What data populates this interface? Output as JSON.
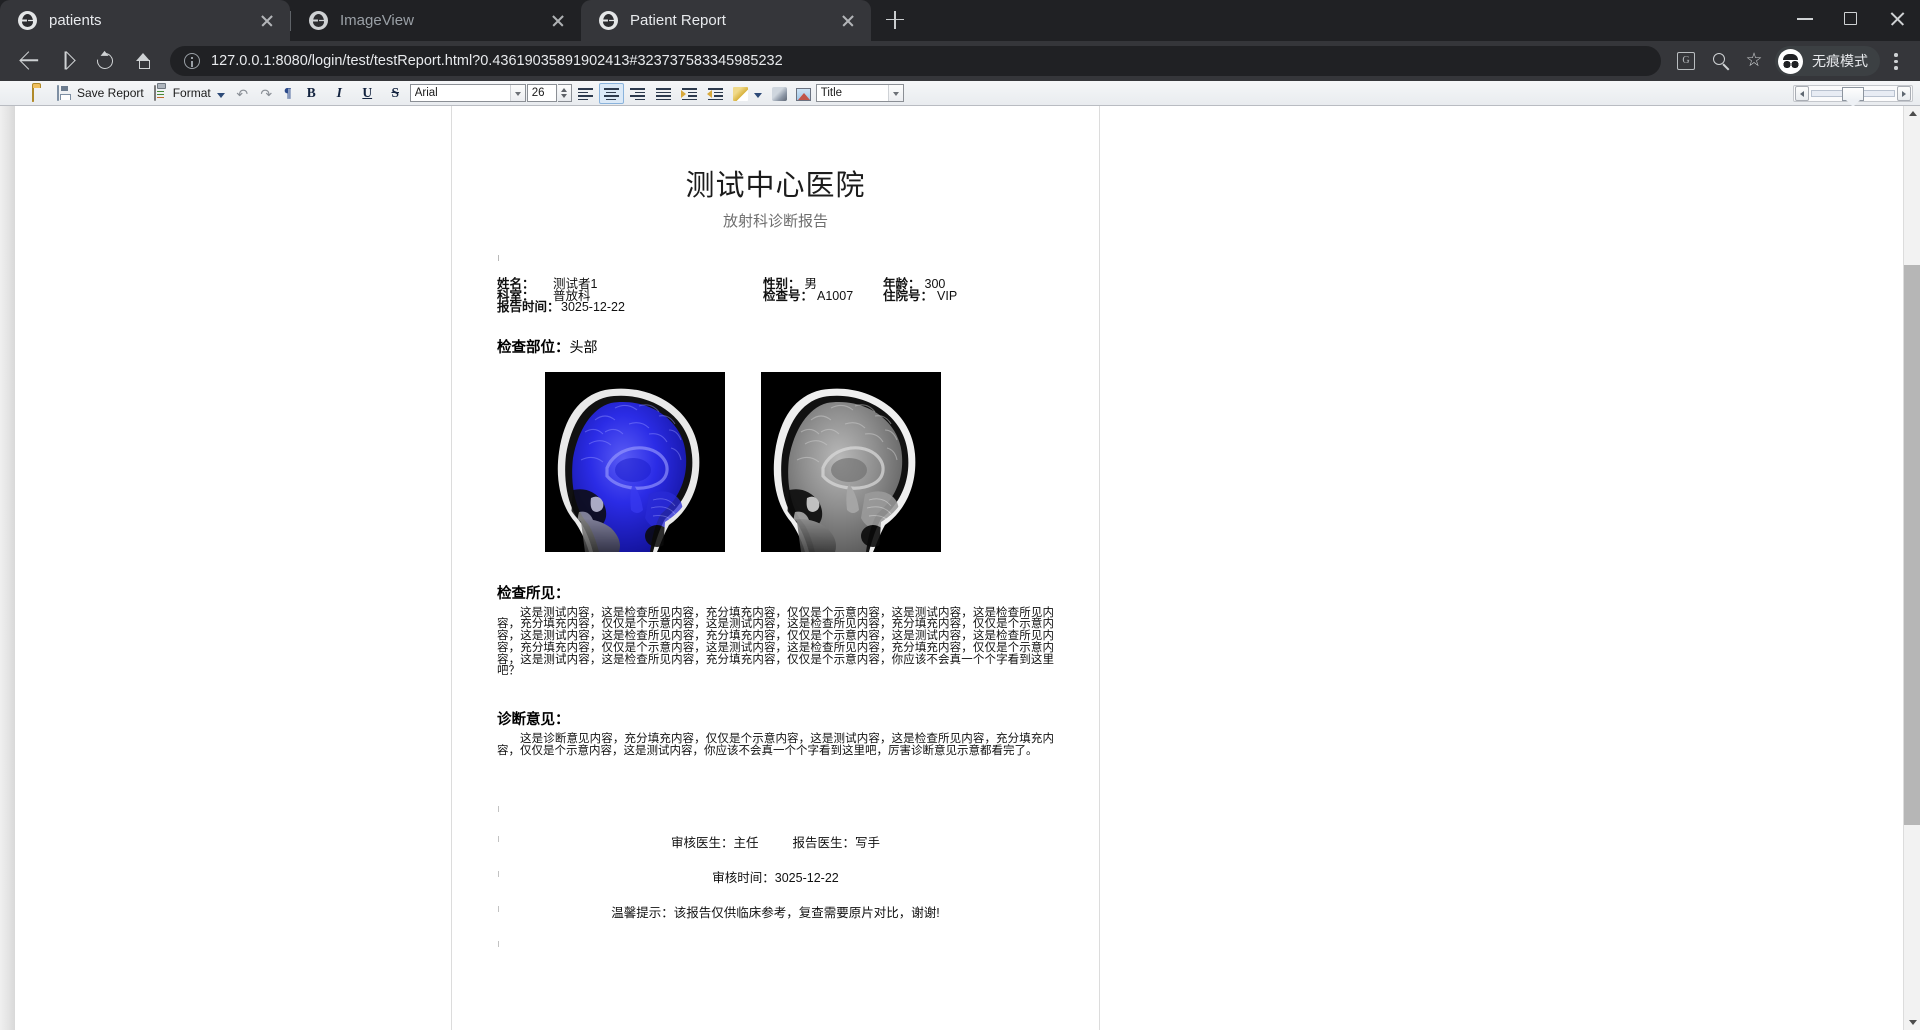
{
  "browser": {
    "tabs": [
      {
        "title": "patients",
        "favicon": "globe-icon",
        "active": false
      },
      {
        "title": "ImageView",
        "favicon": "globe-icon",
        "active": false
      },
      {
        "title": "Patient Report",
        "favicon": "globe-icon",
        "active": true
      }
    ],
    "new_tab_label": "+",
    "window_controls": {
      "minimize": "minimize-icon",
      "maximize": "maximize-icon",
      "close": "close-icon"
    },
    "address": {
      "host": "127.0.0.1",
      "rest": ":8080/login/test/testReport.html?0.43619035891902413#32373758334598523 2",
      "full": "127.0.0.1:8080/login/test/testReport.html?0.43619035891902413#323737583345985232"
    },
    "omni_icons": [
      "translate-icon",
      "search-icon",
      "bookmark-star-icon"
    ],
    "incognito_label": "无痕模式",
    "menu": "kebab-menu-icon"
  },
  "toolbar": {
    "app_icon": "app-icon",
    "open_label": "open-folder-icon",
    "save_label": "Save Report",
    "format_label": "Format",
    "undo_label": "undo-icon",
    "redo_label": "redo-icon",
    "pilcrow_label": "paragraph-mark-icon",
    "bold_label": "B",
    "italic_label": "I",
    "underline_label": "U",
    "strike_label": "S",
    "font_family": "Arial",
    "font_size": "26",
    "align_left": "align-left-icon",
    "align_center": "align-center-icon",
    "align_right": "align-right-icon",
    "align_justify": "align-justify-icon",
    "outdent": "outdent-icon",
    "indent": "indent-icon",
    "highlight": "highlight-icon",
    "brush": "format-painter-icon",
    "image": "insert-image-icon",
    "style_name": "Title",
    "hscroll": {
      "left": "scroll-left-icon",
      "right": "scroll-right-icon",
      "thumb_pct": 50
    }
  },
  "report": {
    "hospital": "测试中心医院",
    "subtitle": "放射科诊断报告",
    "fields": {
      "name_label": "姓名：",
      "name_value": "测试者1",
      "dept_label": "科室：",
      "dept_value": "普放科",
      "report_time_label": "报告时间：",
      "report_time_value": "3025-12-22",
      "gender_label": "性别：",
      "gender_value": "男",
      "exam_no_label": "检查号：",
      "exam_no_value": "A1007",
      "age_label": "年龄：",
      "age_value": "300",
      "inpatient_no_label": "住院号：",
      "inpatient_no_value": "VIP"
    },
    "site_label": "检查部位：",
    "site_value": "头部",
    "images": [
      {
        "name": "mri-sagittal-blue",
        "alt": "脑部矢状位 MRI 彩色标注图"
      },
      {
        "name": "mri-sagittal-gray",
        "alt": "脑部矢状位 MRI 灰度图"
      }
    ],
    "findings_head": "检查所见：",
    "findings_text": "这是测试内容，这是检查所见内容，充分填充内容，仅仅是个示意内容，这是测试内容，这是检查所见内容，充分填充内容，仅仅是个示意内容，这是测试内容，这是检查所见内容，充分填充内容，仅仅是个示意内容，这是测试内容，这是检查所见内容，充分填充内容，仅仅是个示意内容，这是测试内容，这是检查所见内容，充分填充内容，仅仅是个示意内容，这是测试内容，这是检查所见内容，充分填充内容，仅仅是个示意内容，这是测试内容，这是检查所见内容，充分填充内容，仅仅是个示意内容，你应该不会真一个个字看到这里吧？",
    "diagnosis_head": "诊断意见：",
    "diagnosis_text": "这是诊断意见内容，充分填充内容，仅仅是个示意内容，这是测试内容，这是检查所见内容，充分填充内容，仅仅是个示意内容，这是测试内容，你应该不会真一个个字看到这里吧，厉害诊断意见示意都看完了。",
    "footer": {
      "reviewer_label": "审核医生：",
      "reviewer_value": "主任",
      "reporter_label": "报告医生：",
      "reporter_value": "写手",
      "review_time_label": "审核时间：",
      "review_time_value": "3025-12-22",
      "notice": "温馨提示：该报告仅供临床参考，复查需要原片对比，谢谢!"
    }
  },
  "colors": {
    "chrome_bg": "#202124",
    "tab_active": "#35363a",
    "page_bg": "#ffffff",
    "accent_blue": "#2b3ee0",
    "title_gray": "#6f6f6f"
  }
}
